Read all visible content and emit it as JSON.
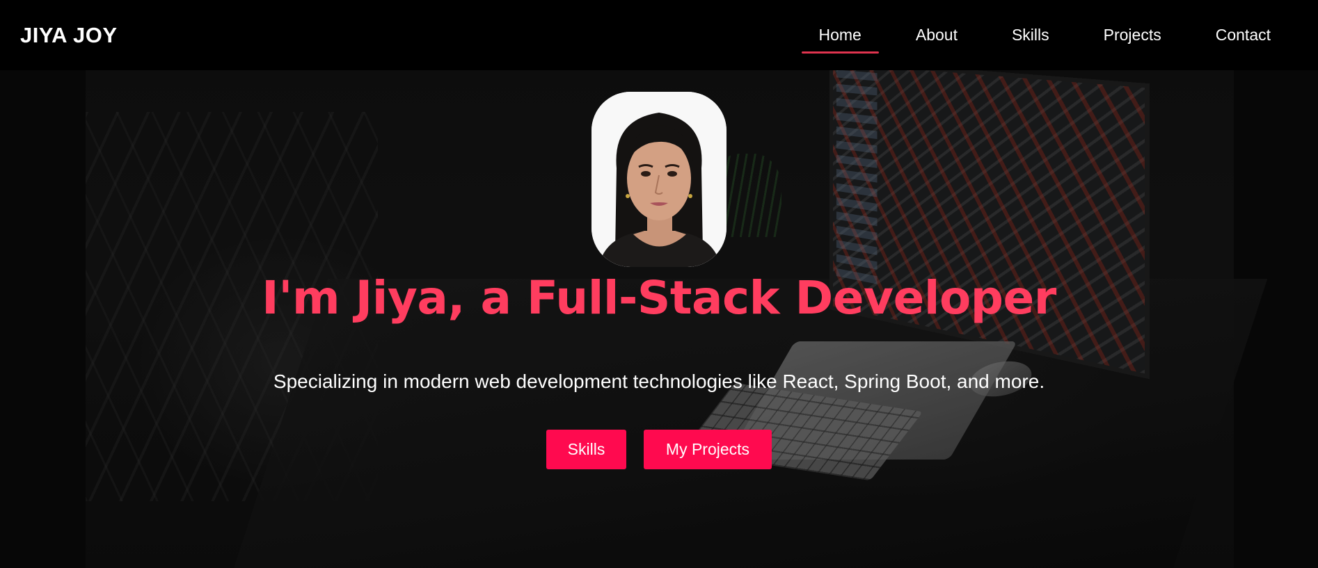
{
  "navbar": {
    "brand": "JIYA JOY",
    "links": [
      {
        "label": "Home",
        "active": true
      },
      {
        "label": "About",
        "active": false
      },
      {
        "label": "Skills",
        "active": false
      },
      {
        "label": "Projects",
        "active": false
      },
      {
        "label": "Contact",
        "active": false
      }
    ]
  },
  "hero": {
    "headline": "I'm Jiya, a Full-Stack Developer",
    "subheadline": "Specializing in modern web development technologies like React, Spring Boot, and more.",
    "buttons": {
      "skills_label": "Skills",
      "projects_label": "My Projects"
    }
  },
  "colors": {
    "accent": "#ff3d5f",
    "button": "#ff0a4f",
    "nav_underline": "#e0344f",
    "background": "#000000"
  }
}
